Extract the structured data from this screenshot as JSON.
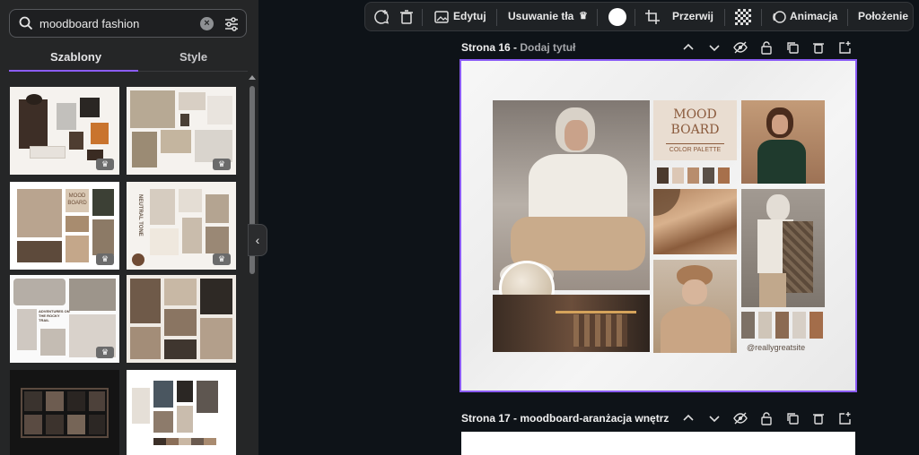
{
  "search": {
    "query": "moodboard fashion"
  },
  "tabs": [
    {
      "label": "Szablony"
    },
    {
      "label": "Style"
    }
  ],
  "toolbar": {
    "edit_label": "Edytuj",
    "bg_remove_label": "Usuwanie tła",
    "crop_label": "Przerwij",
    "animate_label": "Animacja",
    "position_label": "Położenie"
  },
  "pages": [
    {
      "title": "Strona 16 - ",
      "subtitle": "Dodaj tytuł"
    },
    {
      "title": "Strona 17 - moodboard-aranżacja wnętrz",
      "subtitle": ""
    }
  ],
  "canvas": {
    "moodboard_title": "MOOD BOARD",
    "palette_label": "COLOR PALETTE",
    "handle": "@reallygreatsite",
    "palette_top": [
      "#4b3a2e",
      "#dcc7b5",
      "#b88d6d",
      "#5a5048",
      "#a7704b"
    ],
    "palette_bottom": [
      "#7d7166",
      "#cfc5b8",
      "#8b6a52",
      "#d7cfc6",
      "#a36d4a"
    ]
  },
  "thumbnails": [
    {
      "title": "",
      "premium": true
    },
    {
      "title": "",
      "premium": true
    },
    {
      "title": "MOOD BOARD",
      "premium": true
    },
    {
      "title": "NEUTRAL TONE",
      "premium": true
    },
    {
      "title": "ADVENTURES ON THE ROCKY TRAIL",
      "premium": true
    },
    {
      "title": "",
      "premium": false
    },
    {
      "title": "",
      "premium": false
    },
    {
      "title": "",
      "premium": false
    }
  ]
}
